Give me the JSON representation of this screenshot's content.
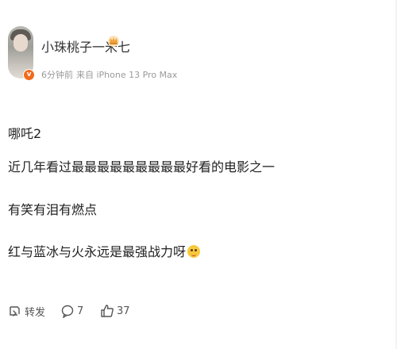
{
  "post": {
    "author": {
      "name": "小珠桃子一米七",
      "avatar_icon": "user-avatar",
      "verified_icon": "verified-badge-icon",
      "vip_icon": "crown-icon"
    },
    "meta": {
      "time": "6分钟前",
      "source": "来自 iPhone 13 Pro Max"
    },
    "lines": [
      "哪吒2",
      "近几年看过最最最最最最最最最好看的电影之一",
      "有笑有泪有燃点",
      "红与蓝冰与火永远是最强战力呀"
    ],
    "emoji_icon": "smile-emoji-icon"
  },
  "actions": {
    "repost_label": "转发",
    "comment_count": "7",
    "like_count": "37"
  },
  "colors": {
    "text": "#222222",
    "meta": "#9a9a9a",
    "badge": "#f26a1b",
    "crown": "#f0a33a"
  }
}
